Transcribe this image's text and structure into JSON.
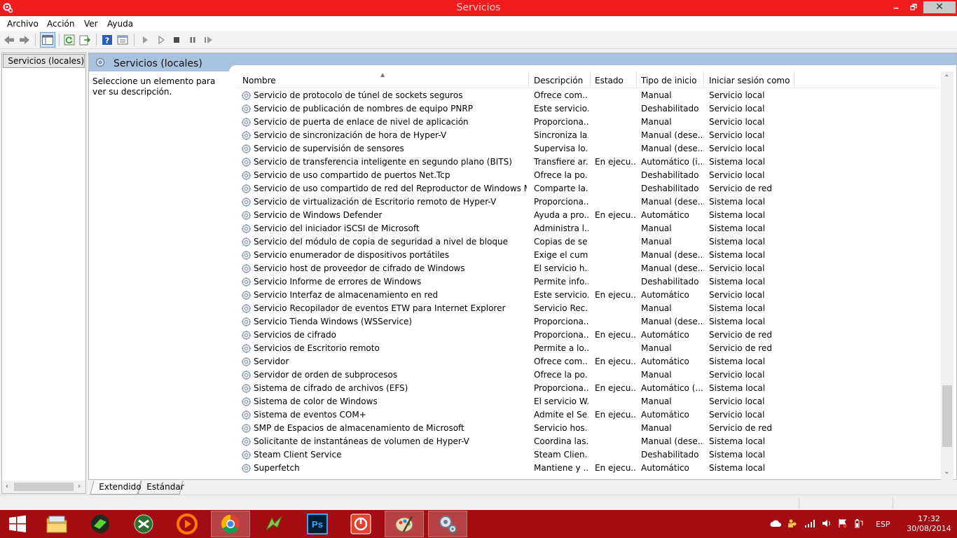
{
  "window": {
    "title": "Servicios",
    "minimize_glyph": "🗕",
    "maximize_glyph": "🗗",
    "close_glyph": "✕"
  },
  "menu": [
    "Archivo",
    "Acción",
    "Ver",
    "Ayuda"
  ],
  "toolbar": {
    "buttons": [
      "back-icon",
      "forward-icon",
      "show-hide-tree-icon",
      "refresh-icon",
      "export-list-icon",
      "help-icon",
      "properties-icon",
      "start-service-icon",
      "start-service-params-icon",
      "stop-service-icon",
      "pause-service-icon",
      "resume-service-icon"
    ]
  },
  "tree": {
    "item_label": "Servicios (locales)",
    "scroll_left": "‹",
    "scroll_right": "›"
  },
  "main": {
    "header_title": "Servicios (locales)",
    "description_text": "Seleccione un elemento para ver su descripción.",
    "columns": {
      "name": "Nombre",
      "description": "Descripción",
      "state": "Estado",
      "startup": "Tipo de inicio",
      "logon": "Iniciar sesión como"
    },
    "scroll_up": "⌃",
    "scroll_down": "⌄",
    "rows": [
      {
        "name": "Servicio de protocolo de túnel de sockets seguros",
        "description": "Ofrece com...",
        "state": "",
        "startup": "Manual",
        "logon": "Servicio local"
      },
      {
        "name": "Servicio de publicación de nombres de equipo PNRP",
        "description": "Este servicio...",
        "state": "",
        "startup": "Deshabilitado",
        "logon": "Servicio local"
      },
      {
        "name": "Servicio de puerta de enlace de nivel de aplicación",
        "description": "Proporciona...",
        "state": "",
        "startup": "Manual",
        "logon": "Servicio local"
      },
      {
        "name": "Servicio de sincronización de hora de Hyper-V",
        "description": "Sincroniza la...",
        "state": "",
        "startup": "Manual (dese...",
        "logon": "Servicio local"
      },
      {
        "name": "Servicio de supervisión de sensores",
        "description": "Supervisa lo...",
        "state": "",
        "startup": "Manual (dese...",
        "logon": "Servicio local"
      },
      {
        "name": "Servicio de transferencia inteligente en segundo plano (BITS)",
        "description": "Transfiere ar...",
        "state": "En ejecu...",
        "startup": "Automático (i...",
        "logon": "Sistema local"
      },
      {
        "name": "Servicio de uso compartido de puertos Net.Tcp",
        "description": "Ofrece la po...",
        "state": "",
        "startup": "Deshabilitado",
        "logon": "Servicio local"
      },
      {
        "name": "Servicio de uso compartido de red del Reproductor de Windows Media",
        "description": "Comparte la...",
        "state": "",
        "startup": "Deshabilitado",
        "logon": "Servicio de red"
      },
      {
        "name": "Servicio de virtualización de Escritorio remoto de Hyper-V",
        "description": "Proporciona...",
        "state": "",
        "startup": "Manual (dese...",
        "logon": "Sistema local"
      },
      {
        "name": "Servicio de Windows Defender",
        "description": "Ayuda a pro...",
        "state": "En ejecu...",
        "startup": "Automático",
        "logon": "Sistema local"
      },
      {
        "name": "Servicio del iniciador iSCSI de Microsoft",
        "description": "Administra l...",
        "state": "",
        "startup": "Manual",
        "logon": "Sistema local"
      },
      {
        "name": "Servicio del módulo de copia de seguridad a nivel de bloque",
        "description": "Copias de se...",
        "state": "",
        "startup": "Manual",
        "logon": "Sistema local"
      },
      {
        "name": "Servicio enumerador de dispositivos portátiles",
        "description": "Exige el cum...",
        "state": "",
        "startup": "Manual (dese...",
        "logon": "Sistema local"
      },
      {
        "name": "Servicio host de proveedor de cifrado de Windows",
        "description": "El servicio h...",
        "state": "",
        "startup": "Manual (dese...",
        "logon": "Servicio local"
      },
      {
        "name": "Servicio Informe de errores de Windows",
        "description": "Permite info...",
        "state": "",
        "startup": "Deshabilitado",
        "logon": "Sistema local"
      },
      {
        "name": "Servicio Interfaz de almacenamiento en red",
        "description": "Este servicio...",
        "state": "En ejecu...",
        "startup": "Automático",
        "logon": "Servicio local"
      },
      {
        "name": "Servicio Recopilador de eventos ETW para Internet Explorer",
        "description": "Servicio Rec...",
        "state": "",
        "startup": "Manual",
        "logon": "Sistema local"
      },
      {
        "name": "Servicio Tienda Windows (WSService)",
        "description": "Proporciona...",
        "state": "",
        "startup": "Manual (dese...",
        "logon": "Sistema local"
      },
      {
        "name": "Servicios de cifrado",
        "description": "Proporciona...",
        "state": "En ejecu...",
        "startup": "Automático",
        "logon": "Servicio de red"
      },
      {
        "name": "Servicios de Escritorio remoto",
        "description": "Permite a lo...",
        "state": "",
        "startup": "Manual",
        "logon": "Servicio de red"
      },
      {
        "name": "Servidor",
        "description": "Ofrece com...",
        "state": "En ejecu...",
        "startup": "Automático",
        "logon": "Sistema local"
      },
      {
        "name": "Servidor de orden de subprocesos",
        "description": "Ofrece la po...",
        "state": "",
        "startup": "Manual",
        "logon": "Servicio local"
      },
      {
        "name": "Sistema de cifrado de archivos (EFS)",
        "description": "Proporciona...",
        "state": "En ejecu...",
        "startup": "Automático (...",
        "logon": "Sistema local"
      },
      {
        "name": "Sistema de color de Windows",
        "description": "El servicio W...",
        "state": "",
        "startup": "Manual",
        "logon": "Servicio local"
      },
      {
        "name": "Sistema de eventos COM+",
        "description": "Admite el Se...",
        "state": "En ejecu...",
        "startup": "Automático",
        "logon": "Servicio local"
      },
      {
        "name": "SMP de Espacios de almacenamiento de Microsoft",
        "description": "Servicio hos...",
        "state": "",
        "startup": "Manual",
        "logon": "Servicio de red"
      },
      {
        "name": "Solicitante de instantáneas de volumen de Hyper-V",
        "description": "Coordina las...",
        "state": "",
        "startup": "Manual (dese...",
        "logon": "Sistema local"
      },
      {
        "name": "Steam Client Service",
        "description": "Steam Clien...",
        "state": "",
        "startup": "Deshabilitado",
        "logon": "Sistema local"
      },
      {
        "name": "Superfetch",
        "description": "Mantiene y ...",
        "state": "En ejecu...",
        "startup": "Automático",
        "logon": "Sistema local"
      }
    ]
  },
  "tabs": [
    "Extendido",
    "Estándar"
  ],
  "taskbar": {
    "apps": [
      "start-icon",
      "file-explorer-icon",
      "media-app-icon",
      "torrent-icon",
      "media-player-icon",
      "chrome-icon",
      "bird-app-icon",
      "photoshop-icon",
      "power-app-icon",
      "paint-icon",
      "services-icon"
    ],
    "photoshop_label": "Ps",
    "language": "ESP",
    "time": "17:32",
    "date": "30/08/2014"
  },
  "colors": {
    "titlebar": "#ee1c1c",
    "taskbar": "#a30d12",
    "panel_header": "#a9c2dd"
  }
}
